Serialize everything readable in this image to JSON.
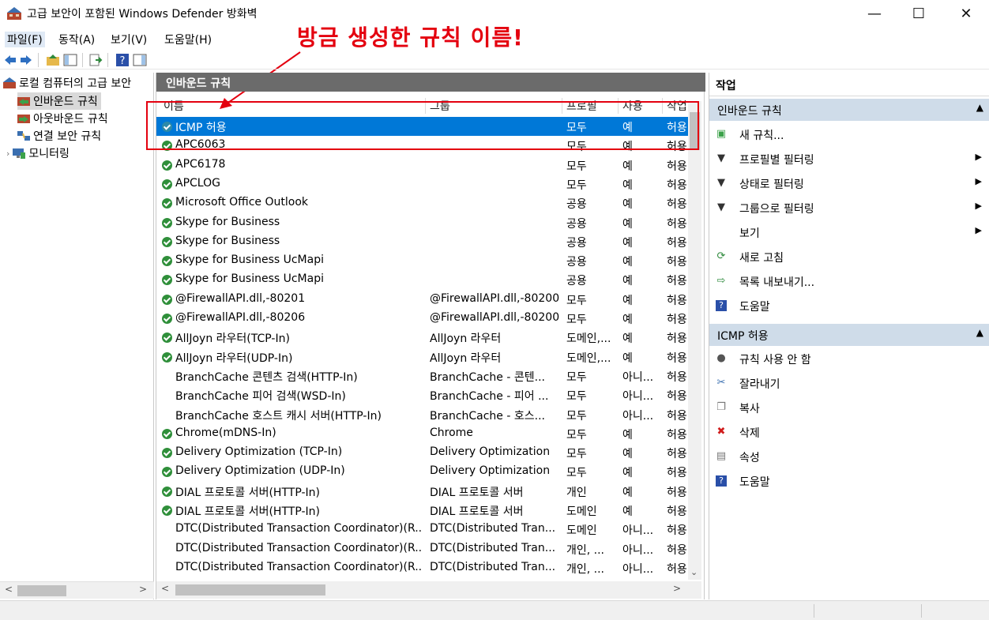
{
  "window": {
    "title": "고급 보안이 포함된 Windows Defender 방화벽",
    "minimize": "—",
    "maximize": "☐",
    "close": "✕"
  },
  "menu": [
    "파일(F)",
    "동작(A)",
    "보기(V)",
    "도움말(H)"
  ],
  "annotation": "방금 생성한 규칙 이름!",
  "tree": {
    "root": "로컬 컴퓨터의 고급 보안",
    "items": [
      "인바운드 규칙",
      "아웃바운드 규칙",
      "연결 보안 규칙",
      "모니터링"
    ]
  },
  "center": {
    "header": "인바운드 규칙",
    "columns": [
      "이름",
      "그룹",
      "프로필",
      "사용",
      "작업"
    ],
    "rows": [
      {
        "name": "ICMP 허용",
        "group": "",
        "profile": "모두",
        "enabled": "예",
        "action": "허용",
        "icon": "shield-check",
        "selected": true
      },
      {
        "name": "APC6063",
        "group": "",
        "profile": "모두",
        "enabled": "예",
        "action": "허용",
        "icon": "check"
      },
      {
        "name": "APC6178",
        "group": "",
        "profile": "모두",
        "enabled": "예",
        "action": "허용",
        "icon": "check"
      },
      {
        "name": "APCLOG",
        "group": "",
        "profile": "모두",
        "enabled": "예",
        "action": "허용",
        "icon": "check"
      },
      {
        "name": "Microsoft Office Outlook",
        "group": "",
        "profile": "공용",
        "enabled": "예",
        "action": "허용",
        "icon": "check"
      },
      {
        "name": "Skype for Business",
        "group": "",
        "profile": "공용",
        "enabled": "예",
        "action": "허용",
        "icon": "check"
      },
      {
        "name": "Skype for Business",
        "group": "",
        "profile": "공용",
        "enabled": "예",
        "action": "허용",
        "icon": "check"
      },
      {
        "name": "Skype for Business UcMapi",
        "group": "",
        "profile": "공용",
        "enabled": "예",
        "action": "허용",
        "icon": "check"
      },
      {
        "name": "Skype for Business UcMapi",
        "group": "",
        "profile": "공용",
        "enabled": "예",
        "action": "허용",
        "icon": "check"
      },
      {
        "name": "@FirewallAPI.dll,-80201",
        "group": "@FirewallAPI.dll,-80200",
        "profile": "모두",
        "enabled": "예",
        "action": "허용",
        "icon": "check"
      },
      {
        "name": "@FirewallAPI.dll,-80206",
        "group": "@FirewallAPI.dll,-80200",
        "profile": "모두",
        "enabled": "예",
        "action": "허용",
        "icon": "check"
      },
      {
        "name": "AllJoyn 라우터(TCP-In)",
        "group": "AllJoyn 라우터",
        "profile": "도메인,...",
        "enabled": "예",
        "action": "허용",
        "icon": "check"
      },
      {
        "name": "AllJoyn 라우터(UDP-In)",
        "group": "AllJoyn 라우터",
        "profile": "도메인,...",
        "enabled": "예",
        "action": "허용",
        "icon": "check"
      },
      {
        "name": "BranchCache 콘텐츠 검색(HTTP-In)",
        "group": "BranchCache - 콘텐...",
        "profile": "모두",
        "enabled": "아니...",
        "action": "허용",
        "icon": "none"
      },
      {
        "name": "BranchCache 피어 검색(WSD-In)",
        "group": "BranchCache - 피어 ...",
        "profile": "모두",
        "enabled": "아니...",
        "action": "허용",
        "icon": "none"
      },
      {
        "name": "BranchCache 호스트 캐시 서버(HTTP-In)",
        "group": "BranchCache - 호스...",
        "profile": "모두",
        "enabled": "아니...",
        "action": "허용",
        "icon": "none"
      },
      {
        "name": "Chrome(mDNS-In)",
        "group": "Chrome",
        "profile": "모두",
        "enabled": "예",
        "action": "허용",
        "icon": "check"
      },
      {
        "name": "Delivery Optimization (TCP-In)",
        "group": "Delivery Optimization",
        "profile": "모두",
        "enabled": "예",
        "action": "허용",
        "icon": "check"
      },
      {
        "name": "Delivery Optimization (UDP-In)",
        "group": "Delivery Optimization",
        "profile": "모두",
        "enabled": "예",
        "action": "허용",
        "icon": "check"
      },
      {
        "name": "DIAL 프로토콜 서버(HTTP-In)",
        "group": "DIAL 프로토콜 서버",
        "profile": "개인",
        "enabled": "예",
        "action": "허용",
        "icon": "check"
      },
      {
        "name": "DIAL 프로토콜 서버(HTTP-In)",
        "group": "DIAL 프로토콜 서버",
        "profile": "도메인",
        "enabled": "예",
        "action": "허용",
        "icon": "check"
      },
      {
        "name": "DTC(Distributed Transaction Coordinator)(R...",
        "group": "DTC(Distributed Tran...",
        "profile": "도메인",
        "enabled": "아니...",
        "action": "허용",
        "icon": "none"
      },
      {
        "name": "DTC(Distributed Transaction Coordinator)(R...",
        "group": "DTC(Distributed Tran...",
        "profile": "개인, ...",
        "enabled": "아니...",
        "action": "허용",
        "icon": "none"
      },
      {
        "name": "DTC(Distributed Transaction Coordinator)(R...",
        "group": "DTC(Distributed Tran...",
        "profile": "개인, ...",
        "enabled": "아니...",
        "action": "허용",
        "icon": "none"
      }
    ]
  },
  "actions": {
    "title": "작업",
    "group1": {
      "label": "인바운드 규칙",
      "items": [
        {
          "label": "새 규칙...",
          "icon": "new-rule-icon",
          "submenu": false
        },
        {
          "label": "프로필별 필터링",
          "icon": "filter-icon",
          "submenu": true
        },
        {
          "label": "상태로 필터링",
          "icon": "filter-icon",
          "submenu": true
        },
        {
          "label": "그룹으로 필터링",
          "icon": "filter-icon",
          "submenu": true
        },
        {
          "label": "보기",
          "icon": "",
          "submenu": true
        },
        {
          "label": "새로 고침",
          "icon": "refresh-icon",
          "submenu": false
        },
        {
          "label": "목록 내보내기...",
          "icon": "export-icon",
          "submenu": false
        },
        {
          "label": "도움말",
          "icon": "help-icon",
          "submenu": false
        }
      ]
    },
    "group2": {
      "label": "ICMP 허용",
      "items": [
        {
          "label": "규칙 사용 안 함",
          "icon": "disable-icon"
        },
        {
          "label": "잘라내기",
          "icon": "cut-icon"
        },
        {
          "label": "복사",
          "icon": "copy-icon"
        },
        {
          "label": "삭제",
          "icon": "delete-icon"
        },
        {
          "label": "속성",
          "icon": "properties-icon"
        },
        {
          "label": "도움말",
          "icon": "help-icon"
        }
      ]
    }
  }
}
